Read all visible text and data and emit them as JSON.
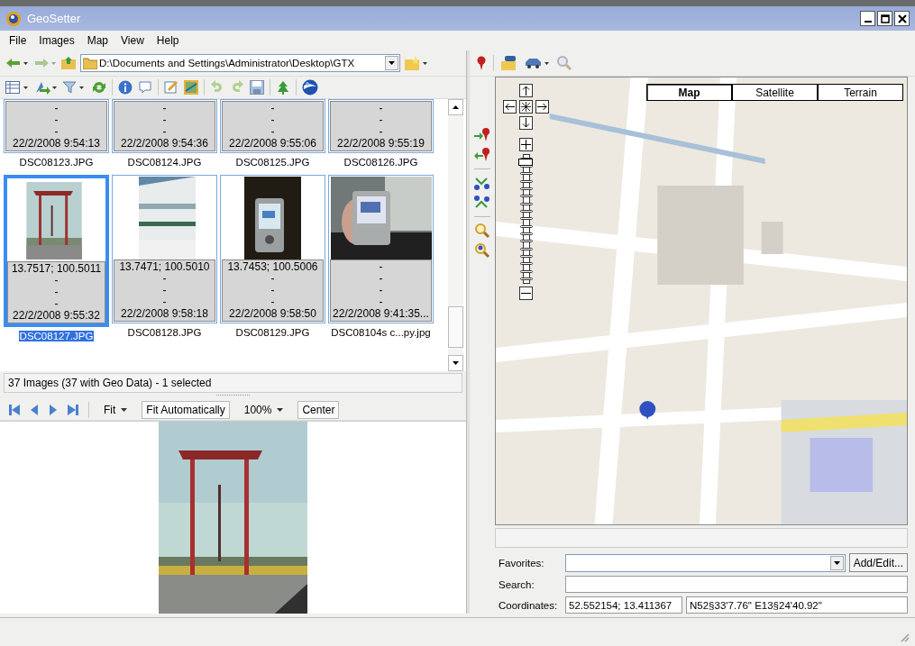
{
  "window": {
    "title": "GeoSetter"
  },
  "menu": [
    "File",
    "Images",
    "Map",
    "View",
    "Help"
  ],
  "path_field": {
    "value": "D:\\Documents and Settings\\Administrator\\Desktop\\GTX"
  },
  "thumbnails": [
    {
      "kind": "info",
      "name": "DSC08123.JPG",
      "lines": [
        "-",
        "-",
        "-",
        "22/2/2008 9:54:13"
      ],
      "selected": false
    },
    {
      "kind": "info",
      "name": "DSC08124.JPG",
      "lines": [
        "-",
        "-",
        "-",
        "22/2/2008 9:54:36"
      ],
      "selected": false
    },
    {
      "kind": "info",
      "name": "DSC08125.JPG",
      "lines": [
        "-",
        "-",
        "-",
        "22/2/2008 9:55:06"
      ],
      "selected": false
    },
    {
      "kind": "info",
      "name": "DSC08126.JPG",
      "lines": [
        "-",
        "-",
        "-",
        "22/2/2008 9:55:19"
      ],
      "selected": false
    },
    {
      "name": "DSC08127.JPG",
      "lines": [
        "13.7517; 100.5011",
        "-",
        "-",
        "-",
        "22/2/2008 9:55:32"
      ],
      "selected": true
    },
    {
      "name": "DSC08128.JPG",
      "lines": [
        "13.7471; 100.5010",
        "-",
        "-",
        "-",
        "22/2/2008 9:58:18"
      ],
      "selected": false
    },
    {
      "name": "DSC08129.JPG",
      "lines": [
        "13.7453; 100.5006",
        "-",
        "-",
        "-",
        "22/2/2008 9:58:50"
      ],
      "selected": false
    },
    {
      "name": "DSC08104s c...py.jpg",
      "lines": [
        "-",
        "-",
        "-",
        "-",
        "22/2/2008 9:41:35..."
      ],
      "selected": false
    }
  ],
  "status": "37 Images (37 with Geo Data) - 1 selected",
  "viewer_buttons": [
    {
      "kind": "dropdown",
      "label": "Fit",
      "on": false
    },
    {
      "kind": "toggle",
      "label": "Fit Automatically",
      "on": true
    },
    {
      "kind": "dropdown",
      "label": "100%",
      "on": false
    },
    {
      "kind": "toggle",
      "label": "Center",
      "on": true
    }
  ],
  "map": {
    "types": [
      {
        "label": "Map",
        "selected": true
      },
      {
        "label": "Satellite",
        "selected": false
      },
      {
        "label": "Terrain",
        "selected": false
      }
    ],
    "zoom": {
      "level": 0.97
    }
  },
  "form": {
    "favorites_label": "Favorites:",
    "add_edit": "Add/Edit...",
    "search_label": "Search:",
    "coordinates_label": "Coordinates:",
    "decimal": "52.552154; 13.411367",
    "dms": "N52§33'7.76\" E13§24'40.92\""
  }
}
